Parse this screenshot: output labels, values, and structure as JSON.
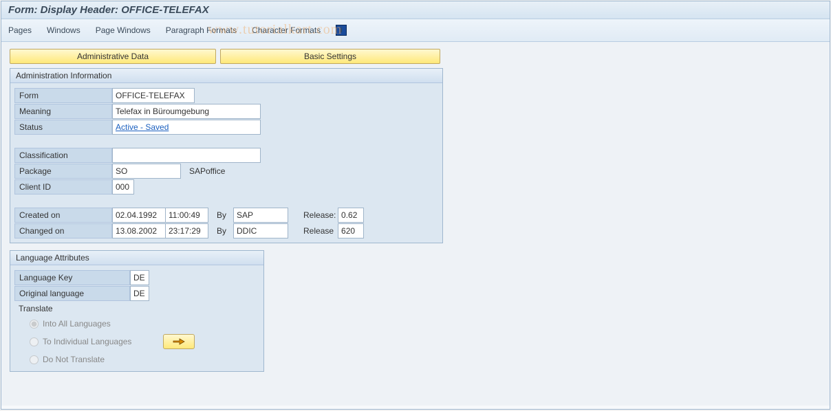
{
  "title": "Form: Display Header: OFFICE-TELEFAX",
  "menu": {
    "pages": "Pages",
    "windows": "Windows",
    "page_windows": "Page Windows",
    "paragraph_formats": "Paragraph Formats",
    "character_formats": "Character Formats"
  },
  "watermark": "www.tutorialkart.com",
  "tabs": {
    "admin_data": "Administrative Data",
    "basic_settings": "Basic Settings"
  },
  "admin": {
    "header": "Administration Information",
    "form_label": "Form",
    "form_value": "OFFICE-TELEFAX",
    "meaning_label": "Meaning",
    "meaning_value": "Telefax in Büroumgebung",
    "status_label": "Status",
    "status_value": "Active - Saved",
    "classification_label": "Classification",
    "classification_value": "",
    "package_label": "Package",
    "package_value": "SO",
    "package_desc": "SAPoffice",
    "client_id_label": "Client ID",
    "client_id_value": "000",
    "created_on_label": "Created on",
    "created_on_date": "02.04.1992",
    "created_on_time": "11:00:49",
    "by_label": "By",
    "created_by": "SAP",
    "release_label": "Release:",
    "created_release": "0.62",
    "changed_on_label": "Changed on",
    "changed_on_date": "13.08.2002",
    "changed_on_time": "23:17:29",
    "changed_by": "DDIC",
    "release2_label": "Release",
    "changed_release": "620"
  },
  "lang": {
    "header": "Language Attributes",
    "lang_key_label": "Language Key",
    "lang_key_value": "DE",
    "orig_lang_label": "Original language",
    "orig_lang_value": "DE",
    "translate_label": "Translate",
    "opt_all": "Into All Languages",
    "opt_individual": "To Individual Languages",
    "opt_none": "Do Not Translate"
  }
}
